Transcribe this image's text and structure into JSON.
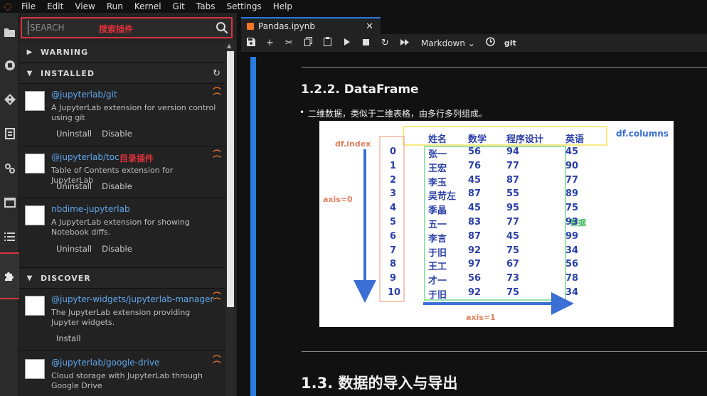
{
  "menu": {
    "items": [
      "File",
      "Edit",
      "View",
      "Run",
      "Kernel",
      "Git",
      "Tabs",
      "Settings",
      "Help"
    ]
  },
  "search": {
    "placeholder": "SEARCH",
    "annotation": "搜索插件"
  },
  "sections": {
    "warning": "WARNING",
    "installed": "INSTALLED",
    "discover": "DISCOVER"
  },
  "installed": [
    {
      "name": "@jupyterlab/git",
      "desc": "A JupyterLab extension for version control using git",
      "uninstall": "Uninstall",
      "disable": "Disable"
    },
    {
      "name": "@jupyterlab/toc",
      "annotation": "目录插件",
      "desc": "Table of Contents extension for JupyterLab",
      "uninstall": "Uninstall",
      "disable": "Disable"
    },
    {
      "name": "nbdime-jupyterlab",
      "desc": "A JupyterLab extension for showing Notebook diffs.",
      "uninstall": "Uninstall",
      "disable": "Disable"
    }
  ],
  "discover": [
    {
      "name": "@jupyter-widgets/jupyterlab-manager",
      "desc": "The JupyterLab extension providing Jupyter widgets.",
      "install": "Install"
    },
    {
      "name": "@jupyterlab/google-drive",
      "desc": "Cloud storage with JupyterLab through Google Drive"
    }
  ],
  "tab": {
    "title": "Pandas.ipynb"
  },
  "toolbar": {
    "cell_type": "Markdown",
    "git": "git"
  },
  "notebook": {
    "h122": "1.2.2. DataFrame",
    "bullet": "二维数据，类似于二维表格，由多行多列组成。",
    "h13": "1.3. 数据的导入与导出"
  },
  "figure": {
    "index_label": "df.index",
    "columns_label": "df.columns",
    "axis0": "axis=0",
    "axis1": "axis=1",
    "data_label": "数据",
    "headers": [
      "姓名",
      "数学",
      "程序设计",
      "英语"
    ],
    "index": [
      "0",
      "1",
      "2",
      "3",
      "4",
      "5",
      "6",
      "7",
      "8",
      "9",
      "10"
    ],
    "rows": [
      [
        "张一",
        "56",
        "94",
        "45"
      ],
      [
        "王宏",
        "76",
        "77",
        "90"
      ],
      [
        "李玉",
        "45",
        "87",
        "77"
      ],
      [
        "吴苛左",
        "87",
        "55",
        "89"
      ],
      [
        "季晶",
        "45",
        "95",
        "75"
      ],
      [
        "五一",
        "83",
        "77",
        "93"
      ],
      [
        "李言",
        "87",
        "45",
        "99"
      ],
      [
        "于旧",
        "92",
        "75",
        "34"
      ],
      [
        "王工",
        "97",
        "67",
        "56"
      ],
      [
        "才一",
        "56",
        "73",
        "78"
      ],
      [
        "于旧",
        "92",
        "75",
        "34"
      ]
    ]
  },
  "colors": {
    "accent": "#2a7bde",
    "annotation": "#e0303b",
    "jupyter_orange": "#f37726",
    "link": "#5fa8ee"
  }
}
